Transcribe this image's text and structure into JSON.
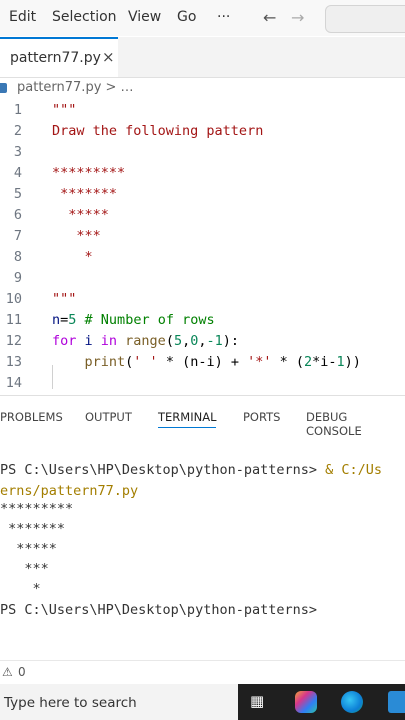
{
  "menubar": {
    "items": [
      "Edit",
      "Selection",
      "View",
      "Go",
      "···"
    ],
    "back_icon": "arrow-left-icon",
    "forward_icon": "arrow-right-icon"
  },
  "tab": {
    "label": "pattern77.py",
    "close": "×"
  },
  "breadcrumb": {
    "text": "pattern77.py > …"
  },
  "editor": {
    "lines": [
      {
        "n": "1",
        "text": "\"\"\""
      },
      {
        "n": "2",
        "text": "Draw the following pattern"
      },
      {
        "n": "3",
        "text": ""
      },
      {
        "n": "4",
        "text": "*********"
      },
      {
        "n": "5",
        "text": " *******"
      },
      {
        "n": "6",
        "text": "  *****"
      },
      {
        "n": "7",
        "text": "   ***"
      },
      {
        "n": "8",
        "text": "    *"
      },
      {
        "n": "9",
        "text": ""
      },
      {
        "n": "10",
        "text": "\"\"\""
      },
      {
        "n": "11",
        "text": "n=5 # Number of rows"
      },
      {
        "n": "12",
        "text": "for i in range(5,0,-1):"
      },
      {
        "n": "13",
        "text": "    print(' ' * (n-i) + '*' * (2*i-1))"
      },
      {
        "n": "14",
        "text": ""
      }
    ],
    "line11": {
      "var": "n",
      "eq": "=",
      "num": "5",
      "comment": " # Number of rows"
    },
    "line12": {
      "kw_for": "for",
      "var": " i ",
      "kw_in": "in",
      "fn": " range",
      "args1": "(",
      "n1": "5",
      "c1": ",",
      "n2": "0",
      "c2": ",",
      "n3": "-1",
      "end": "):"
    },
    "line13": {
      "indent": "    ",
      "fn": "print",
      "p1": "(",
      "s1": "' '",
      "p2": " * (n-i) + ",
      "s2": "'*'",
      "p3": " * (",
      "n1": "2",
      "p4": "*i-",
      "n2": "1",
      "p5": "))"
    }
  },
  "panel": {
    "tabs": [
      "PROBLEMS",
      "OUTPUT",
      "TERMINAL",
      "PORTS",
      "DEBUG CONSOLE"
    ],
    "active": "TERMINAL"
  },
  "terminal": {
    "prompt1_path": "PS C:\\Users\\HP\\Desktop\\python-patterns>",
    "prompt1_cmd": " & C:/Us",
    "line2": "erns/pattern77.py",
    "output": [
      "*********",
      " *******",
      "  *****",
      "   ***",
      "    *"
    ],
    "prompt2": "PS C:\\Users\\HP\\Desktop\\python-patterns>"
  },
  "statusbar": {
    "problems_count": "0",
    "warning_icon": "warning-icon"
  },
  "taskbar": {
    "search_placeholder": "Type here to search",
    "icons": [
      "task-view-icon",
      "copilot-icon",
      "edge-icon",
      "vscode-icon"
    ]
  }
}
